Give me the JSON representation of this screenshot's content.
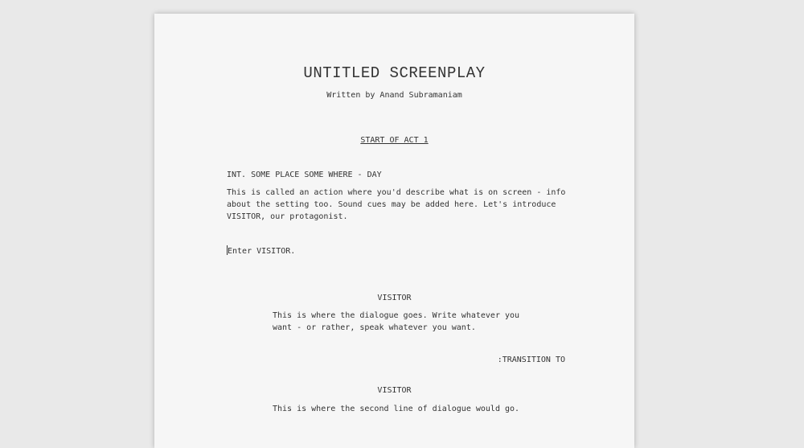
{
  "title": "UNTITLED SCREENPLAY",
  "byline": "Written by Anand Subramaniam",
  "act_header": "START OF ACT 1",
  "scene_heading": "INT. SOME PLACE SOME WHERE - DAY",
  "action_1": "This is called an action where you'd describe what is on screen - info about the setting too. Sound cues may be added here. Let's introduce VISITOR, our protagonist.",
  "action_2": "Enter VISITOR.",
  "character_1": "VISITOR",
  "dialogue_1": "This is where the dialogue goes. Write whatever you want - or rather, speak whatever you want.",
  "transition": ":TRANSITION TO",
  "character_2": "VISITOR",
  "dialogue_2": "This is where the second line of dialogue would go."
}
